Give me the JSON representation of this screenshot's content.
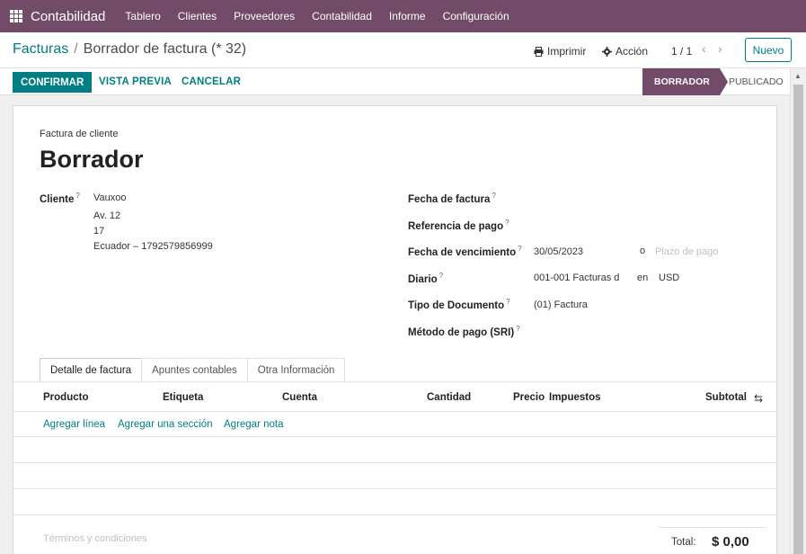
{
  "navbar": {
    "app_name": "Contabilidad",
    "menu": [
      "Tablero",
      "Clientes",
      "Proveedores",
      "Contabilidad",
      "Informe",
      "Configuración"
    ]
  },
  "breadcrumb": {
    "parent": "Facturas",
    "separator": "/",
    "current": "Borrador de factura (* 32)"
  },
  "control": {
    "print_label": "Imprimir",
    "action_label": "Acción",
    "pager": "1 / 1",
    "new_label": "Nuevo"
  },
  "statusbar": {
    "confirm_label": "CONFIRMAR",
    "preview_label": "VISTA PREVIA",
    "cancel_label": "CANCELAR",
    "stages": [
      "BORRADOR",
      "PUBLICADO"
    ],
    "active_stage": "BORRADOR"
  },
  "form": {
    "doc_type": "Factura de cliente",
    "title": "Borrador",
    "customer": {
      "label": "Cliente",
      "name": "Vauxoo",
      "address_line1": "Av. 12",
      "address_line2": "17",
      "address_line3": "Ecuador – 1792579856999"
    },
    "invoice_date": {
      "label": "Fecha de factura",
      "value": ""
    },
    "payment_ref": {
      "label": "Referencia de pago",
      "value": ""
    },
    "due_date": {
      "label": "Fecha de vencimiento",
      "value": "30/05/2023",
      "or": "o",
      "terms_placeholder": "Plazo de pago"
    },
    "journal": {
      "label": "Diario",
      "value": "001-001 Facturas d",
      "in": "en",
      "currency": "USD"
    },
    "doc_type_field": {
      "label": "Tipo de Documento",
      "value": "(01) Factura"
    },
    "payment_method": {
      "label": "Método de pago (SRI)",
      "value": ""
    }
  },
  "tabs": [
    "Detalle de factura",
    "Apuntes contables",
    "Otra Información"
  ],
  "table": {
    "headers": [
      "Producto",
      "Etiqueta",
      "Cuenta",
      "Cantidad",
      "Precio",
      "Impuestos",
      "Subtotal"
    ],
    "add_line": "Agregar línea",
    "add_section": "Agregar una sección",
    "add_note": "Agregar nota"
  },
  "footer": {
    "terms_placeholder": "Términos y condiciones",
    "total_label": "Total:",
    "total_value": "$ 0,00"
  },
  "colors": {
    "brand": "#714b67",
    "accent": "#017e84"
  }
}
